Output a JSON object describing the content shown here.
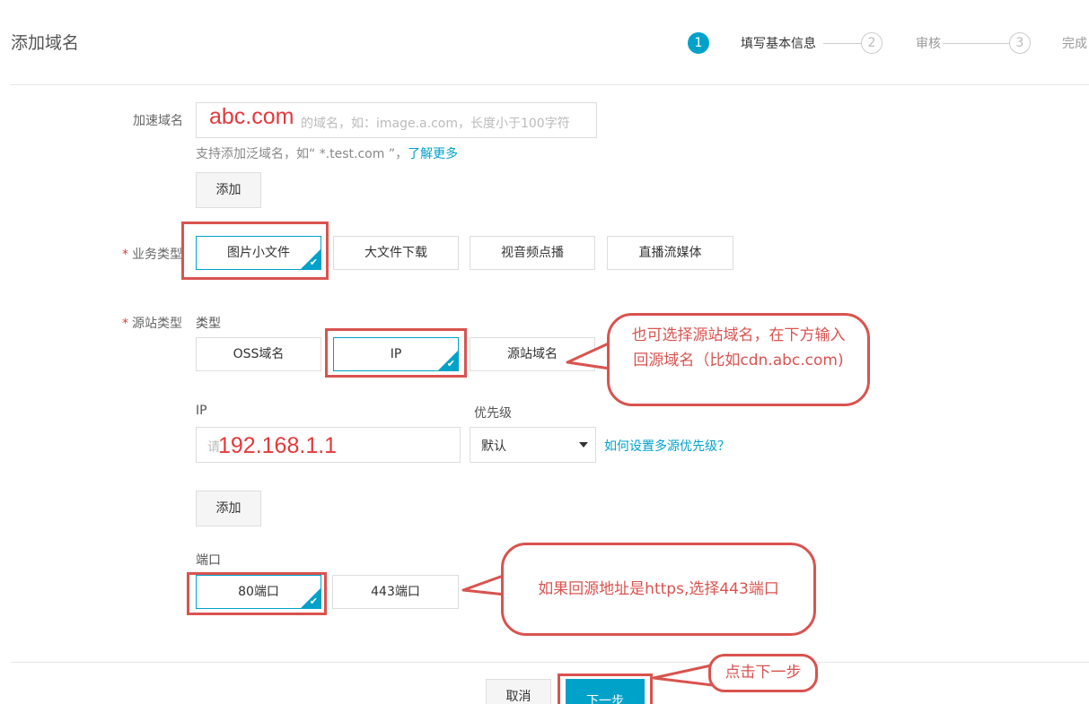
{
  "page": {
    "title": "添加域名"
  },
  "steps": [
    {
      "number": "1",
      "label": "填写基本信息"
    },
    {
      "number": "2",
      "label": "审核"
    },
    {
      "number": "3",
      "label": "完成"
    }
  ],
  "domain": {
    "label": "加速域名",
    "placeholder": "请输入需要加速的域名，如：image.a.com，长度小于100字符",
    "placeholder_visible": "的域名，如：image.a.com，长度小于100字符",
    "value": "abc.com",
    "hint_text": "支持添加泛域名，如“ *.test.com ”，",
    "learn_more_link": "了解更多",
    "add_button": "添加"
  },
  "business_type": {
    "label": "业务类型",
    "required_mark": "*",
    "options": [
      "图片小文件",
      "大文件下载",
      "视音频点播",
      "直播流媒体"
    ],
    "selected": "图片小文件"
  },
  "origin_type": {
    "label": "源站类型",
    "required_mark": "*",
    "sub_label": "类型",
    "options": [
      "OSS域名",
      "IP",
      "源站域名"
    ],
    "selected": "IP"
  },
  "ip_section": {
    "ip_label": "IP",
    "ip_placeholder_visible": "请",
    "ip_value": "192.168.1.1",
    "priority_label": "优先级",
    "priority_value": "默认",
    "priority_help_link": "如何设置多源优先级？",
    "add_button": "添加"
  },
  "port": {
    "label": "端口",
    "options": [
      "80端口",
      "443端口"
    ],
    "selected": "80端口"
  },
  "footer": {
    "cancel_button": "取消",
    "next_button": "下一步"
  },
  "callouts": {
    "origin_domain_tip": "也可选择源站域名，在下方输入回源域名（比如cdn.abc.com)",
    "https_tip": "如果回源地址是https,选择443端口",
    "next_tip": "点击下一步"
  },
  "colors": {
    "accent": "#00a2ca",
    "annotation_red": "#d9534f"
  }
}
